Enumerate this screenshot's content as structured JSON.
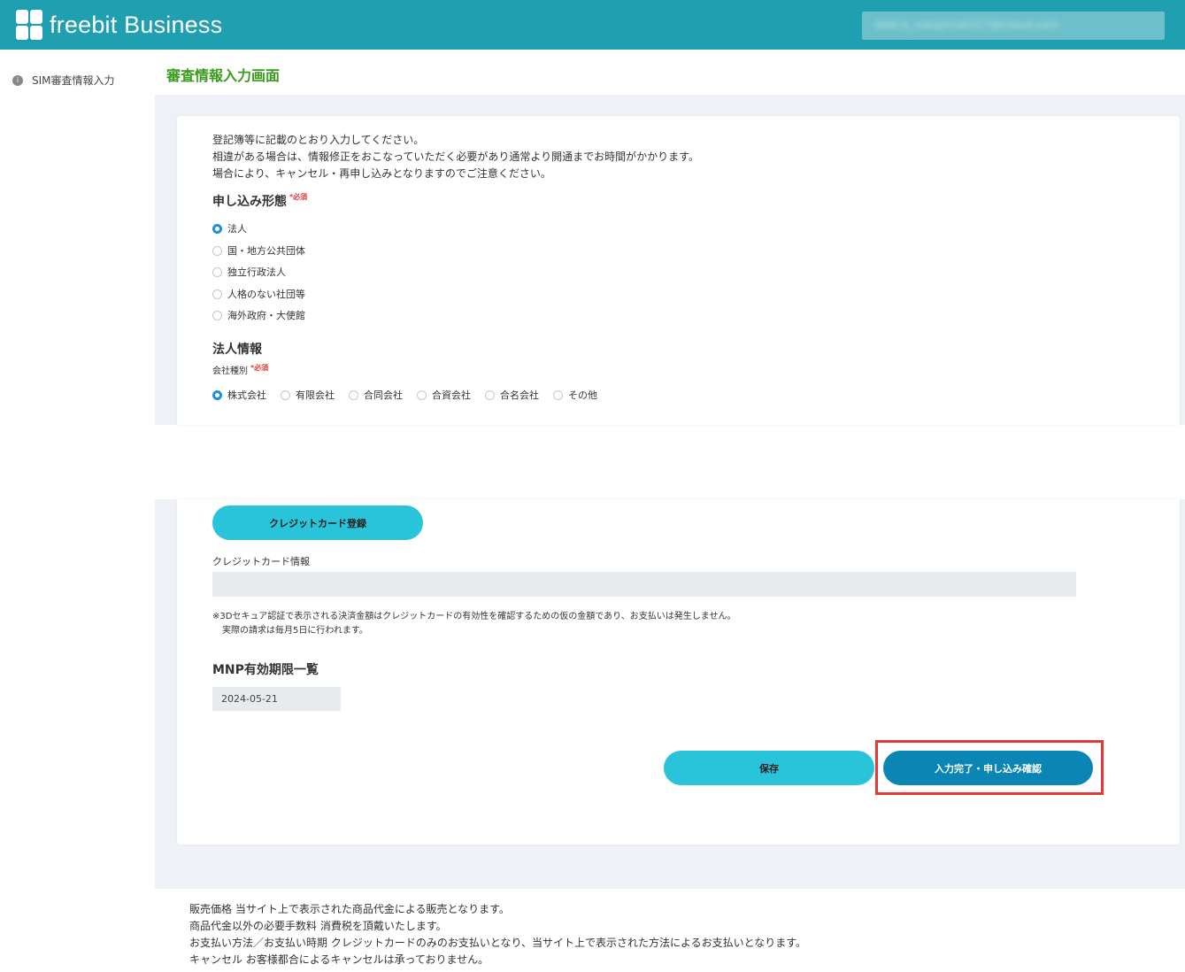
{
  "header": {
    "logo_text": "freebit Business",
    "user_account": "daiki.k_nakajima0327@icloud.com"
  },
  "sidebar": {
    "items": [
      {
        "label": "SIM審査情報入力",
        "icon": "info-icon"
      }
    ]
  },
  "page": {
    "title": "審査情報入力画面"
  },
  "intro": {
    "line1": "登記簿等に記載のとおり入力してください。",
    "line2": "相違がある場合は、情報修正をおこなっていただく必要があり通常より開通までお時間がかかります。",
    "line3": "場合により、キャンセル・再申し込みとなりますのでご注意ください。"
  },
  "application_type": {
    "title": "申し込み形態",
    "required": "*必須",
    "options": [
      "法人",
      "国・地方公共団体",
      "独立行政法人",
      "人格のない社団等",
      "海外政府・大使館"
    ],
    "selected": "法人"
  },
  "corporate_info": {
    "title": "法人情報",
    "company_type_label": "会社種別",
    "required": "*必須",
    "options": [
      "株式会社",
      "有限会社",
      "合同会社",
      "合資会社",
      "合名会社",
      "その他"
    ],
    "selected": "株式会社"
  },
  "credit_card": {
    "register_button": "クレジットカード登録",
    "info_label": "クレジットカード情報",
    "info_value": "",
    "note_line1": "※3Dセキュア認証で表示される決済金額はクレジットカードの有効性を確認するための仮の金額であり、お支払いは発生しません。",
    "note_line2": "実際の請求は毎月5日に行われます。"
  },
  "mnp": {
    "title": "MNP有効期限一覧",
    "date": "2024-05-21"
  },
  "actions": {
    "save_label": "保存",
    "confirm_label": "入力完了・申し込み確認"
  },
  "footer": {
    "line1": "販売価格 当サイト上で表示された商品代金による販売となります。",
    "line2": "商品代金以外の必要手数料 消費税を頂戴いたします。",
    "line3": "お支払い方法／お支払い時期 クレジットカードのみのお支払いとなり、当サイト上で表示された方法によるお支払いとなります。",
    "line4": "キャンセル お客様都合によるキャンセルは承っておりません。"
  },
  "colors": {
    "header_bg": "#1f9fb0",
    "title_green": "#3b9b1c",
    "button_cyan": "#29c4d9",
    "button_primary": "#0b86b4",
    "highlight_red": "#e53935",
    "radio_selected": "#1e8fd8"
  }
}
